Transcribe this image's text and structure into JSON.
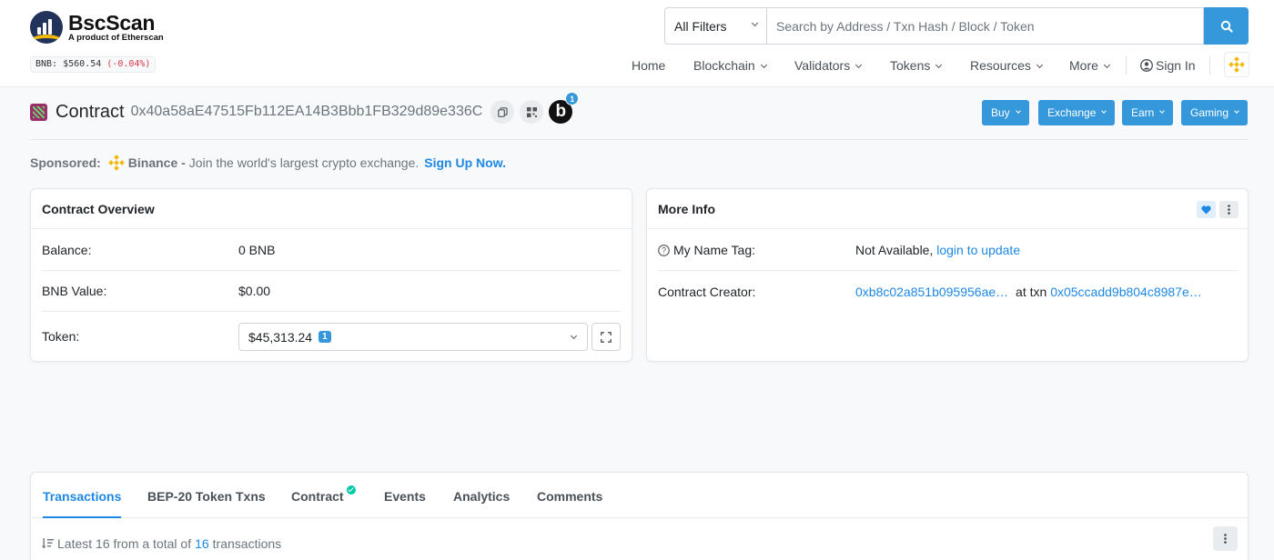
{
  "header": {
    "logo_name": "BscScan",
    "logo_subtitle": "A product of Etherscan",
    "price_label": "BNB: $560.54",
    "price_change": "(-0.04%)",
    "search_filter": "All Filters",
    "search_placeholder": "Search by Address / Txn Hash / Block / Token",
    "nav": [
      "Home",
      "Blockchain",
      "Validators",
      "Tokens",
      "Resources",
      "More"
    ],
    "sign_in": "Sign In"
  },
  "page": {
    "title_label": "Contract",
    "address": "0x40a58aE47515Fb112EA14B3Bbb1FB329d89e336C",
    "b_badge": "b",
    "b_count": "1",
    "actions": [
      "Buy",
      "Exchange",
      "Earn",
      "Gaming"
    ]
  },
  "sponsor": {
    "label": "Sponsored:",
    "brand": "Binance -",
    "text": "Join the world's largest crypto exchange.",
    "link": "Sign Up Now."
  },
  "overview": {
    "title": "Contract Overview",
    "balance_label": "Balance:",
    "balance_value": "0 BNB",
    "value_label": "BNB Value:",
    "value_value": "$0.00",
    "token_label": "Token:",
    "token_value": "$45,313.24",
    "token_count": "1"
  },
  "more_info": {
    "title": "More Info",
    "name_tag_label": "My Name Tag:",
    "name_tag_value": "Not Available,",
    "name_tag_link": "login to update",
    "creator_label": "Contract Creator:",
    "creator_address": "0xb8c02a851b095956ae…",
    "creator_at": "at txn",
    "creator_txn": "0x05ccadd9b804c8987e…"
  },
  "tabs": {
    "items": [
      "Transactions",
      "BEP-20 Token Txns",
      "Contract",
      "Events",
      "Analytics",
      "Comments"
    ],
    "latest_prefix": "Latest 16 from a total of",
    "latest_count": "16",
    "latest_suffix": "transactions"
  },
  "colors": {
    "accent": "#3498db",
    "link": "#1e88e5",
    "negative": "#dc3545",
    "binance_yellow": "#f0b90b",
    "verified": "#00c9a7"
  }
}
